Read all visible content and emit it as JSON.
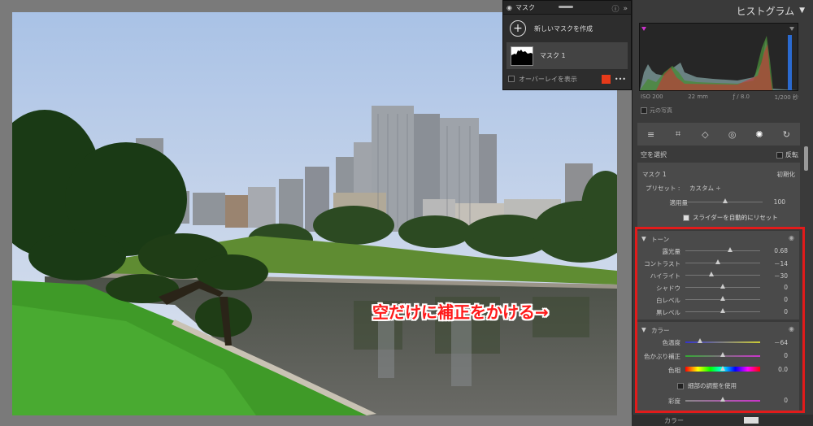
{
  "annotation": "空だけに補正をかける→",
  "mask_panel": {
    "title": "マスク",
    "new_mask": "新しいマスクを作成",
    "mask_name": "マスク 1",
    "overlay_label": "オーバーレイを表示",
    "overlay_color": "#e63a1a",
    "more": "•••"
  },
  "right_panel": {
    "histogram_title": "ヒストグラム",
    "exif": {
      "iso": "ISO 200",
      "focal": "22 mm",
      "aperture": "ƒ / 8.0",
      "shutter": "1/200 秒"
    },
    "original_photo": "元の写真",
    "select_sky": "空を選択",
    "invert": "反転",
    "mask_label": "マスク 1",
    "reset": "初期化",
    "preset_label": "プリセット :",
    "preset_value": "カスタム ÷",
    "amount_label": "適用量",
    "amount_value": "100",
    "auto_reset": "スライダーを自動的にリセット",
    "tone_title": "トーン",
    "tone": [
      {
        "label": "露光量",
        "value": "0.68",
        "pos": 0.6
      },
      {
        "label": "コントラスト",
        "value": "－14",
        "pos": 0.43
      },
      {
        "label": "ハイライト",
        "value": "－30",
        "pos": 0.35
      },
      {
        "label": "シャドウ",
        "value": "0",
        "pos": 0.5
      },
      {
        "label": "白レベル",
        "value": "0",
        "pos": 0.5
      },
      {
        "label": "黒レベル",
        "value": "0",
        "pos": 0.5
      }
    ],
    "color_title": "カラー",
    "color": [
      {
        "label": "色温度",
        "value": "－64",
        "pos": 0.2
      },
      {
        "label": "色かぶり補正",
        "value": "0",
        "pos": 0.5
      },
      {
        "label": "色相",
        "value": "0.0",
        "pos": 0.5
      }
    ],
    "fine_adjust": "細部の調整を使用",
    "saturation_label": "彩度",
    "saturation_value": "0",
    "saturation_pos": 0.5,
    "bottom_label": "カラー"
  },
  "colors": {
    "highlight_box": "#e21b1b"
  }
}
